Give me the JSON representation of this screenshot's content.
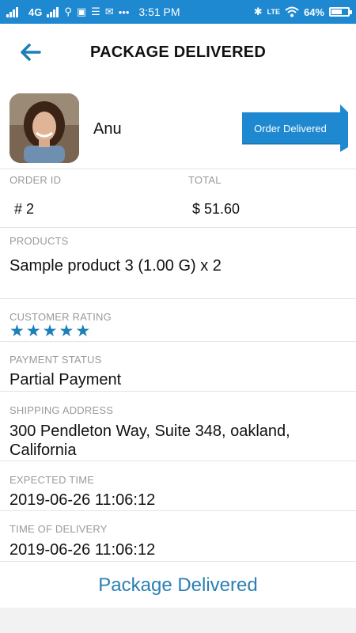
{
  "status_bar": {
    "network": "4G",
    "time": "3:51 PM",
    "volte": "LTE",
    "battery": "64%",
    "battery_level": 0.64,
    "icons": [
      "signal-icon",
      "usb-icon",
      "storage-icon",
      "mail-icon",
      "more-icon",
      "bluetooth-icon",
      "wifi-icon",
      "battery-icon"
    ]
  },
  "header": {
    "title": "PACKAGE DELIVERED",
    "back_icon": "arrow-left-icon"
  },
  "customer": {
    "name": "Anu",
    "avatar": "customer-avatar"
  },
  "badge": {
    "label": "Order Delivered",
    "color": "#1e88d0"
  },
  "order": {
    "id_label": "ORDER ID",
    "id_value": "# 2",
    "total_label": "TOTAL",
    "total_value": "$ 51.60"
  },
  "products": {
    "label": "PRODUCTS",
    "value": "Sample product 3 (1.00 G) x 2"
  },
  "rating": {
    "label": "CUSTOMER RATING",
    "stars": 5,
    "max": 5,
    "color": "#1b7fb8"
  },
  "payment": {
    "label": "PAYMENT STATUS",
    "value": "Partial Payment"
  },
  "shipping": {
    "label": "SHIPPING ADDRESS",
    "line1": "300 Pendleton Way, Suite 348, oakland,",
    "line2": "California"
  },
  "expected_time": {
    "label": "EXPECTED TIME",
    "value": "2019-06-26 11:06:12"
  },
  "delivery_time": {
    "label": "TIME OF DELIVERY",
    "value": "2019-06-26 11:06:12"
  },
  "footer": {
    "button_label": "Package Delivered",
    "color": "#2b7fb4"
  }
}
